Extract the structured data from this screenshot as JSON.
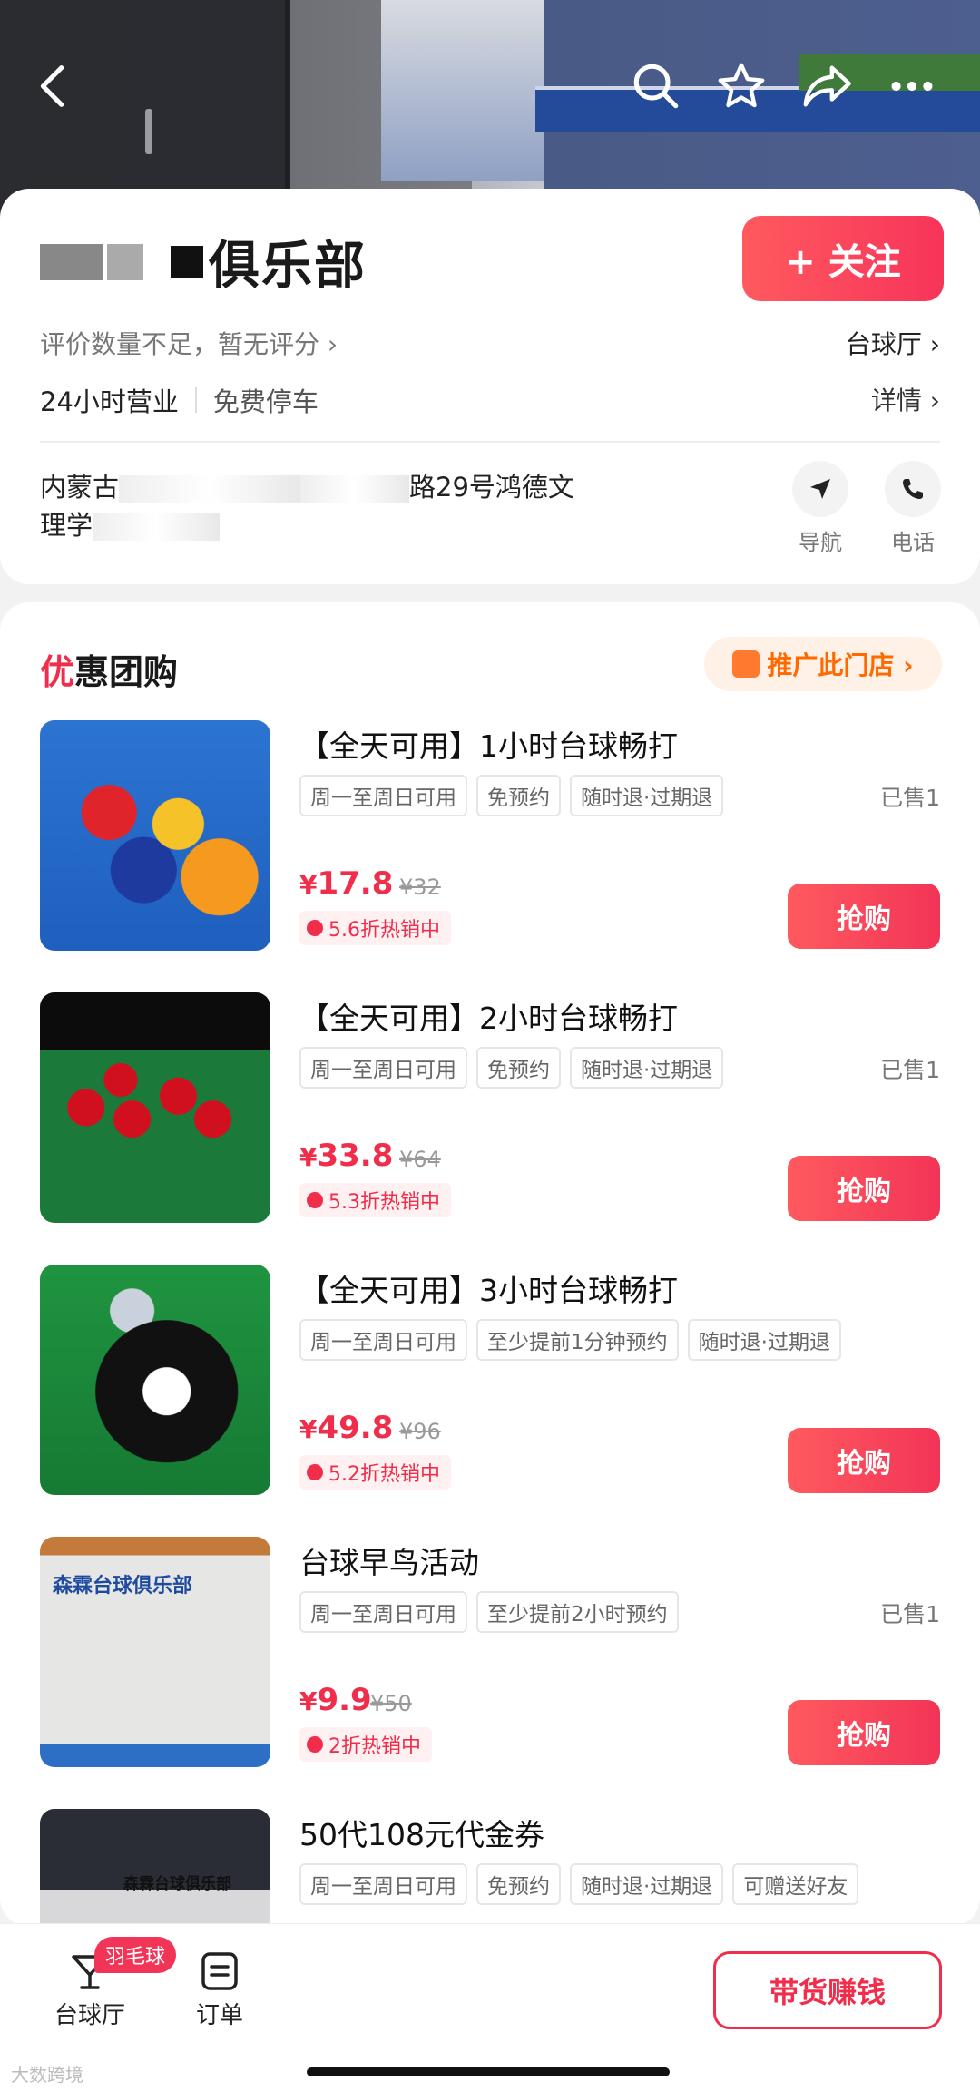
{
  "hero": {
    "icons": [
      "back-icon",
      "search-icon",
      "star-icon",
      "share-icon",
      "more-icon"
    ]
  },
  "store": {
    "name_suffix": "俱乐部",
    "follow_label": "+ 关注",
    "rating_text": "评价数量不足，暂无评分 ›",
    "category": "台球厅 ›",
    "hours": "24小时营业",
    "parking": "免费停车",
    "details": "详情 ›",
    "address_line1_pre": "内蒙古",
    "address_line1_post": "路29号鸿德文",
    "address_line2": "理学",
    "nav_label": "导航",
    "phone_label": "电话"
  },
  "deals_section": {
    "title_accent": "优",
    "title_rest": "惠团购",
    "promote_label": "推广此门店 ›"
  },
  "deals": [
    {
      "name": "【全天可用】1小时台球畅打",
      "tags": [
        "周一至周日可用",
        "免预约",
        "随时退·过期退"
      ],
      "sold": "已售1",
      "price": "17.8",
      "original": "¥32",
      "discount": "5.6折热销中",
      "buy": "抢购"
    },
    {
      "name": "【全天可用】2小时台球畅打",
      "tags": [
        "周一至周日可用",
        "免预约",
        "随时退·过期退"
      ],
      "sold": "已售1",
      "price": "33.8",
      "original": "¥64",
      "discount": "5.3折热销中",
      "buy": "抢购"
    },
    {
      "name": "【全天可用】3小时台球畅打",
      "tags": [
        "周一至周日可用",
        "至少提前1分钟预约",
        "随时退·过期退"
      ],
      "sold": "",
      "price": "49.8",
      "original": "¥96",
      "discount": "5.2折热销中",
      "buy": "抢购"
    },
    {
      "name": "台球早鸟活动",
      "tags": [
        "周一至周日可用",
        "至少提前2小时预约"
      ],
      "sold": "已售1",
      "price": "9.9",
      "original": "¥50",
      "discount": "2折热销中",
      "buy": "抢购",
      "thumb_text": "森霖台球俱乐部"
    },
    {
      "name": "50代108元代金券",
      "tags": [
        "周一至周日可用",
        "免预约",
        "随时退·过期退",
        "可赠送好友"
      ],
      "thumb_text": "森霖台球俱乐部"
    }
  ],
  "currency": "¥",
  "bottom": {
    "tab1_label": "台球厅",
    "tab1_badge": "羽毛球",
    "tab2_label": "订单",
    "earn_label": "带货赚钱",
    "watermark": "大数跨境"
  },
  "colors": {
    "accent": "#f02d4a",
    "promote": "#ff6a00"
  }
}
